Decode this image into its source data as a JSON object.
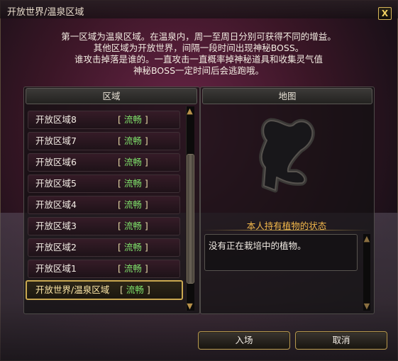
{
  "window": {
    "title": "开放世界/温泉区域",
    "close_label": "X"
  },
  "description": [
    "第一区域为温泉区域。在温泉内，周一至周日分别可获得不同的增益。",
    "其他区域为开放世界，间隔一段时间出现神秘BOSS。",
    "谁攻击掉落是谁的。一直攻击一直概率掉神秘道具和收集灵气值",
    "神秘BOSS一定时间后会逃跑哦。"
  ],
  "zone_header": "区域",
  "map_header": "地图",
  "zones": [
    {
      "name": "开放区域8",
      "bracket_open": "[",
      "status": "流畅",
      "bracket_close": "]"
    },
    {
      "name": "开放区域7",
      "bracket_open": "[",
      "status": "流畅",
      "bracket_close": "]"
    },
    {
      "name": "开放区域6",
      "bracket_open": "[",
      "status": "流畅",
      "bracket_close": "]"
    },
    {
      "name": "开放区域5",
      "bracket_open": "[",
      "status": "流畅",
      "bracket_close": "]"
    },
    {
      "name": "开放区域4",
      "bracket_open": "[",
      "status": "流畅",
      "bracket_close": "]"
    },
    {
      "name": "开放区域3",
      "bracket_open": "[",
      "status": "流畅",
      "bracket_close": "]"
    },
    {
      "name": "开放区域2",
      "bracket_open": "[",
      "status": "流畅",
      "bracket_close": "]"
    },
    {
      "name": "开放区域1",
      "bracket_open": "[",
      "status": "流畅",
      "bracket_close": "]"
    },
    {
      "name": "开放世界/温泉区域",
      "bracket_open": "[",
      "status": "流畅",
      "bracket_close": "]",
      "selected": true
    }
  ],
  "plant_status": {
    "title": "本人持有植物的状态",
    "text": "没有正在栽培中的植物。"
  },
  "buttons": {
    "enter": "入场",
    "cancel": "取消"
  },
  "colors": {
    "status_ok": "#7ee06a",
    "accent_gold": "#c9a850",
    "status_title": "#f3b84b"
  }
}
